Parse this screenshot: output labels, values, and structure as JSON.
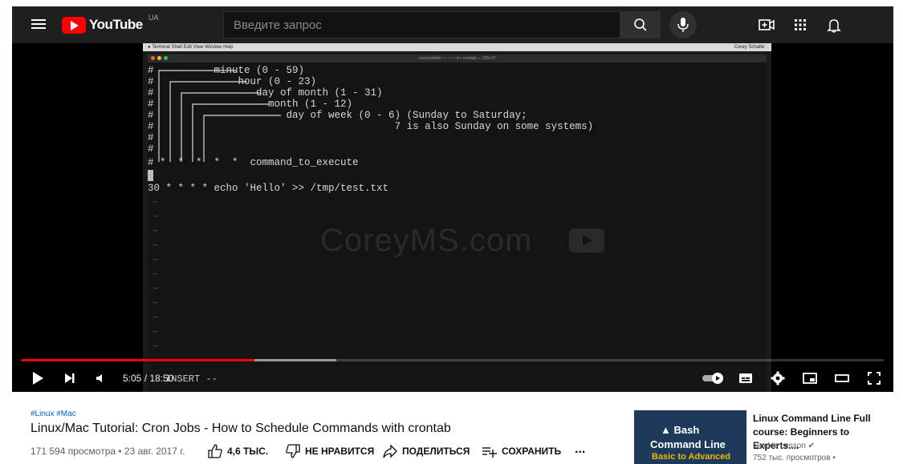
{
  "header": {
    "logo_text": "YouTube",
    "country_code": "UA",
    "search_placeholder": "Введите запрос"
  },
  "terminal": {
    "menubar": "Terminal   Shell   Edit   View   Window   Help",
    "menubar_right": "Corey Schafer",
    "window_title": "coreyschafer — ~ — vi • crontab — 115×27",
    "lines": [
      "#          minute (0 - 59)",
      "#              hour (0 - 23)",
      "#                 day of month (1 - 31)",
      "#                   month (1 - 12)",
      "#                      day of week (0 - 6) (Sunday to Saturday;",
      "                                        7 is also Sunday on some systems)",
      "#",
      "#",
      "# *  *  *  *  *  command_to_execute",
      "30 * * * * echo 'Hello' >> /tmp/test.txt"
    ],
    "mode_line": "INSERT --",
    "watermark": "CoreyMS.com"
  },
  "player": {
    "time": "5:05 / 18:50",
    "progress_played": 0.27,
    "progress_buffered": 0.365
  },
  "video": {
    "tags": "#Linux #Mac",
    "title": "Linux/Mac Tutorial: Cron Jobs - How to Schedule Commands with crontab",
    "meta": "171 594 просмотра • 23 авг. 2017 г.",
    "like_label": "4,6 ТЫС.",
    "dislike_label": "НЕ НРАВИТСЯ",
    "share_label": "ПОДЕЛИТЬСЯ",
    "save_label": "СОХРАНИТЬ",
    "more_label": "..."
  },
  "related": {
    "thumb_line1": "Bash",
    "thumb_line2": "Command Line",
    "thumb_line3": "Basic to Advanced",
    "title": "Linux Command Line Full course: Beginners to Experts....",
    "channel": "Geek's Lesson",
    "views": "752 тыс. просмотров •"
  },
  "colors": {
    "brand_red": "#ff0000",
    "link_blue": "#065fd4",
    "topbar_bg": "#1f1f1f"
  }
}
